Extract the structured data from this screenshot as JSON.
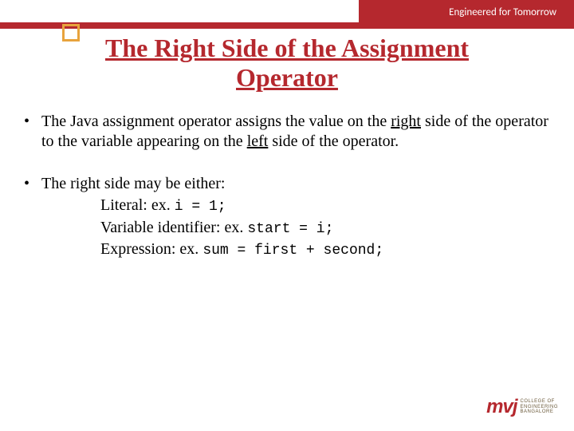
{
  "header": {
    "tagline": "Engineered for Tomorrow"
  },
  "title": "The Right Side of the Assignment Operator",
  "bullets": {
    "b1_pre": "The Java assignment operator assigns the value on the ",
    "b1_u1": "right",
    "b1_mid": " side of the operator to the variable appearing on the ",
    "b1_u2": "left",
    "b1_post": " side of the operator.",
    "b2": "The right side may be either:",
    "sub1_label": "Literal: ex. ",
    "sub1_code": "i = 1;",
    "sub2_label": "Variable identifier: ex. ",
    "sub2_code": "start = i;",
    "sub3_label": "Expression: ex. ",
    "sub3_code": "sum = first + second;"
  },
  "logo": {
    "mark": "mvj",
    "line1": "COLLEGE OF",
    "line2": "ENGINEERING",
    "line3": "BANGALORE"
  }
}
